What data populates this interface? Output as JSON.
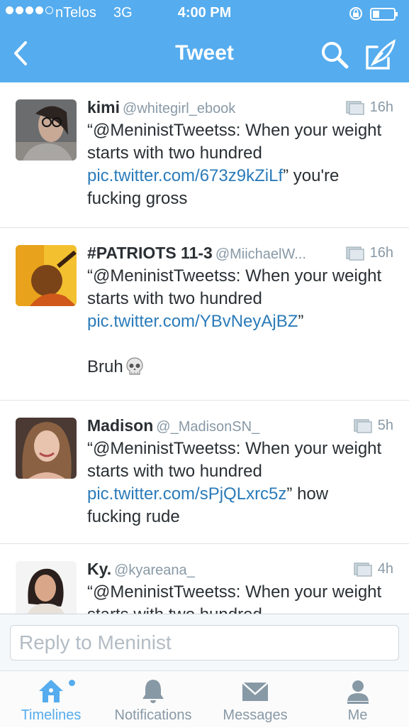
{
  "status_bar": {
    "carrier": "nTelos",
    "network": "3G",
    "time": "4:00 PM"
  },
  "nav": {
    "title": "Tweet"
  },
  "colors": {
    "brand": "#55acee",
    "link": "#2b7bb9",
    "muted": "#8899a6"
  },
  "tweets": [
    {
      "name": "kimi",
      "handle": "@whitegirl_ebook",
      "time": "16h",
      "text_before": "“@MeninistTweetss: When your weight starts with two hundred ",
      "link": "pic.twitter.com/673z9kZiLf",
      "text_after": "” you're fucking gross"
    },
    {
      "name": "#PATRIOTS 11-3",
      "handle": "@MiichaelW...",
      "time": "16h",
      "text_before": "“@MeninistTweetss: When your weight starts with two hundred ",
      "link": "pic.twitter.com/YBvNeyAjBZ",
      "text_after": "”\n\nBruh",
      "emoji": "skull-icon"
    },
    {
      "name": "Madison",
      "handle": "@_MadisonSN_",
      "time": "5h",
      "text_before": "“@MeninistTweetss: When your weight starts with two hundred ",
      "link": "pic.twitter.com/sPjQLxrc5z",
      "text_after": "” how fucking rude"
    },
    {
      "name": "Ky.",
      "handle": "@kyareana_",
      "time": "4h",
      "text_before": "“@MeninistTweetss: When your weight starts with two hundred",
      "link": "",
      "text_after": ""
    }
  ],
  "reply": {
    "placeholder": "Reply to Meninist"
  },
  "tabs": [
    {
      "label": "Timelines",
      "icon": "home-icon",
      "active": true
    },
    {
      "label": "Notifications",
      "icon": "bell-icon",
      "active": false
    },
    {
      "label": "Messages",
      "icon": "envelope-icon",
      "active": false
    },
    {
      "label": "Me",
      "icon": "person-icon",
      "active": false
    }
  ]
}
